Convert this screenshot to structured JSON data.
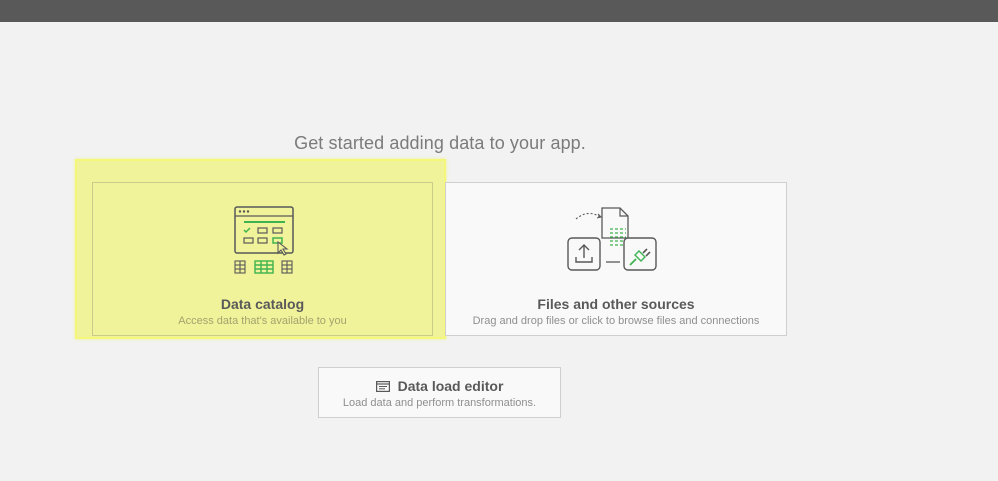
{
  "heading": "Get started adding data to your app.",
  "cards": [
    {
      "title": "Data catalog",
      "description": "Access data that's available to you",
      "icon": "data-catalog-icon"
    },
    {
      "title": "Files and other sources",
      "description": "Drag and drop files or click to browse files and connections",
      "icon": "files-sources-icon"
    }
  ],
  "editor": {
    "title": "Data load editor",
    "description": "Load data and perform transformations.",
    "icon": "script-editor-icon"
  },
  "colors": {
    "topbar": "#595959",
    "background": "#f2f2f2",
    "highlight": "#f1f39a",
    "accent_green": "#3fb34f"
  }
}
